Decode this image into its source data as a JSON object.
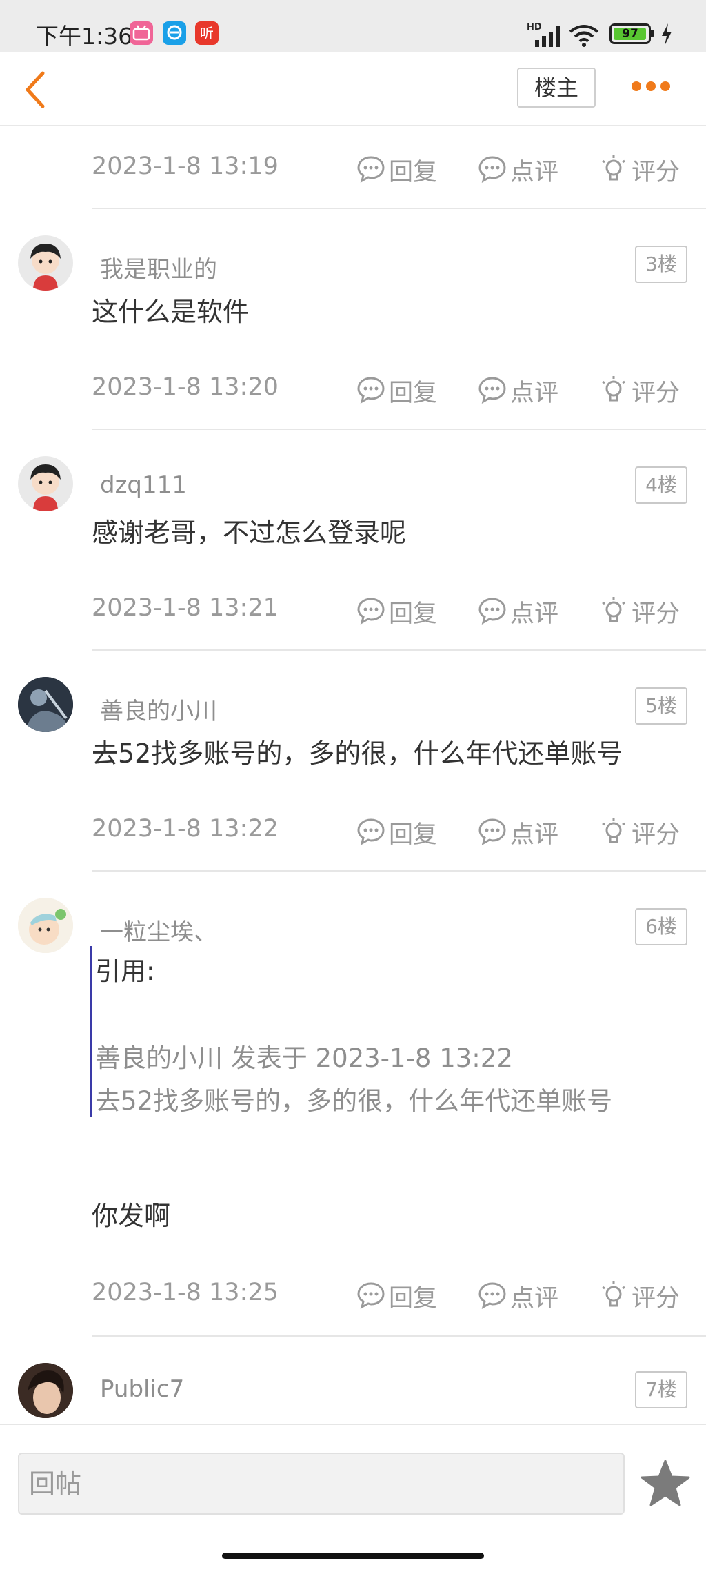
{
  "status_bar": {
    "time": "下午1:36",
    "app_icons": [
      "bilibili",
      "ele-me",
      "ting"
    ],
    "ting_label": "听",
    "hd_label": "HD",
    "battery_level": "97",
    "battery_fraction": 0.97
  },
  "nav": {
    "owner_label": "楼主",
    "icons": [
      "back-arrow-icon",
      "more-dots-icon"
    ],
    "accent_color": "#f07a1a"
  },
  "actions": {
    "reply": "回复",
    "comment": "点评",
    "rate": "评分"
  },
  "posts": [
    {
      "date": "2023-1-8 13:19"
    },
    {
      "username": "我是职业的",
      "floor": "3楼",
      "text": "这什么是软件",
      "date": "2023-1-8 13:20"
    },
    {
      "username": "dzq111",
      "floor": "4楼",
      "text": "感谢老哥，不过怎么登录呢",
      "date": "2023-1-8 13:21"
    },
    {
      "username": "善良的小川",
      "floor": "5楼",
      "text": "去52找多账号的，多的很，什么年代还单账号",
      "date": "2023-1-8 13:22"
    },
    {
      "username": "一粒尘埃、",
      "floor": "6楼",
      "quote_head": "引用:",
      "quote_author_line": "善良的小川 发表于 2023-1-8 13:22",
      "quote_text": "去52找多账号的，多的很，什么年代还单账号",
      "text": "你发啊",
      "date": "2023-1-8 13:25"
    },
    {
      "username": "Public7",
      "floor": "7楼"
    }
  ],
  "bottom_bar": {
    "reply_placeholder": "回帖",
    "favorite_icon": "star-icon"
  }
}
